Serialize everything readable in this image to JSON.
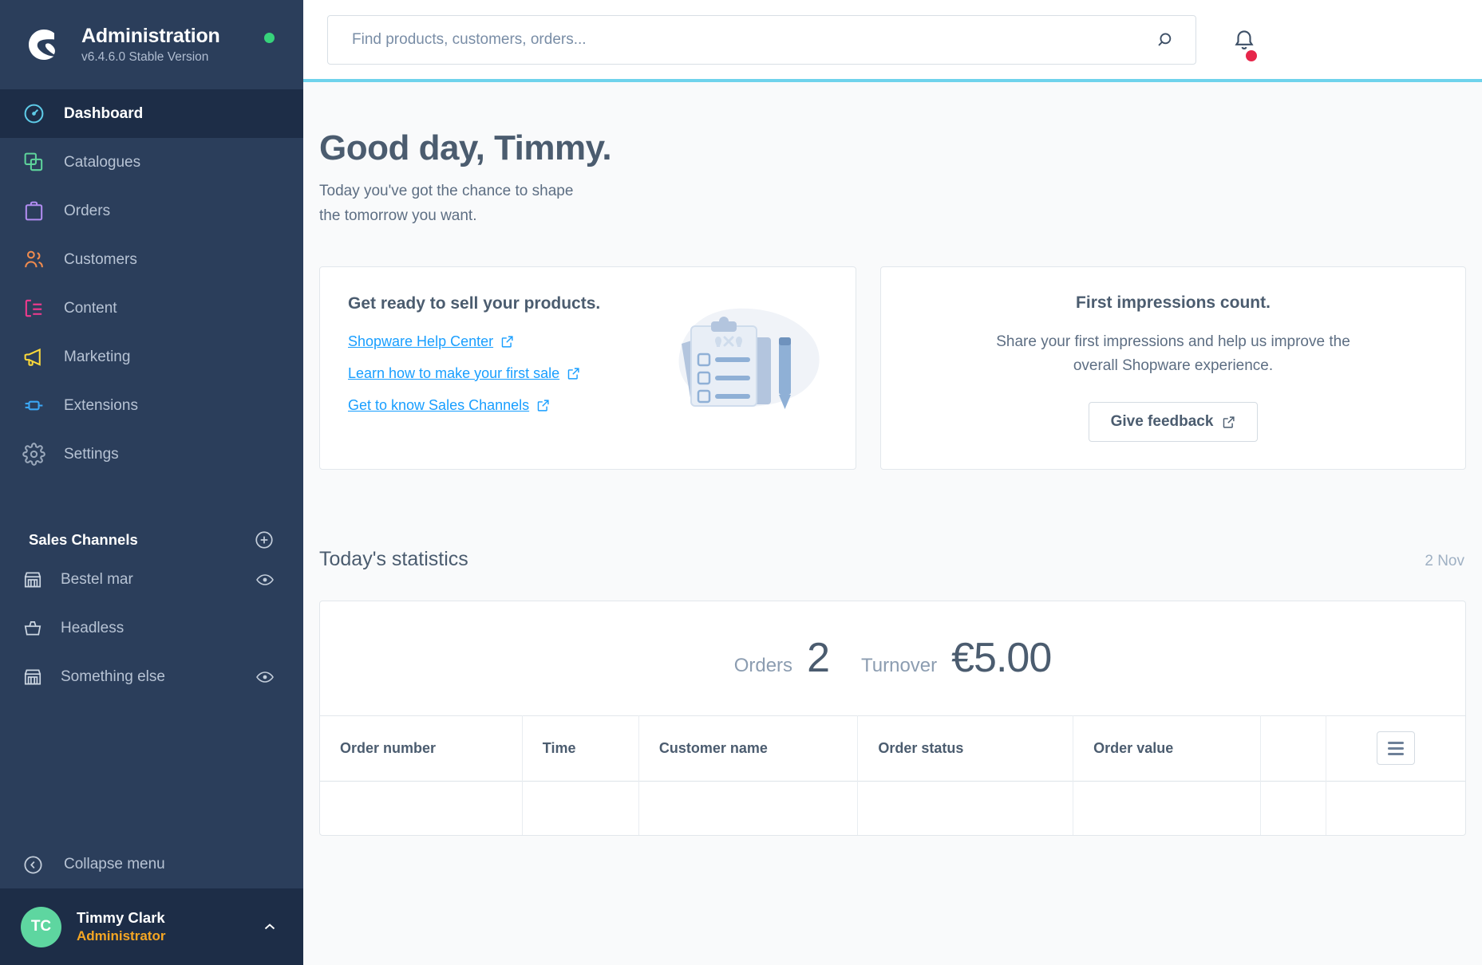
{
  "sidebar": {
    "brand": {
      "title": "Administration",
      "version": "v6.4.6.0 Stable Version",
      "status_dot_color": "#37d37b"
    },
    "nav": [
      {
        "label": "Dashboard",
        "icon": "gauge-icon",
        "color": "#5ecbe8",
        "active": true
      },
      {
        "label": "Catalogues",
        "icon": "copy-icon",
        "color": "#5ed39b",
        "active": false
      },
      {
        "label": "Orders",
        "icon": "bag-icon",
        "color": "#b18cf0",
        "active": false
      },
      {
        "label": "Customers",
        "icon": "users-icon",
        "color": "#f08b4e",
        "active": false
      },
      {
        "label": "Content",
        "icon": "content-icon",
        "color": "#f23a8e",
        "active": false
      },
      {
        "label": "Marketing",
        "icon": "megaphone-icon",
        "color": "#fcd93a",
        "active": false
      },
      {
        "label": "Extensions",
        "icon": "plug-icon",
        "color": "#3ba6f5",
        "active": false
      },
      {
        "label": "Settings",
        "icon": "gear-icon",
        "color": "#9aa8bb",
        "active": false
      }
    ],
    "sales_channels": {
      "title": "Sales Channels",
      "add_label": "+",
      "items": [
        {
          "label": "Bestel mar",
          "icon": "storefront-icon",
          "has_eye": true
        },
        {
          "label": "Headless",
          "icon": "basket-icon",
          "has_eye": false
        },
        {
          "label": "Something else",
          "icon": "storefront-icon",
          "has_eye": true
        }
      ]
    },
    "collapse": {
      "label": "Collapse menu",
      "icon": "chevron-left-circle-icon"
    },
    "user": {
      "initials": "TC",
      "name": "Timmy Clark",
      "role": "Administrator",
      "avatar_color": "#5ed6a0",
      "role_color": "#f5a623"
    }
  },
  "topbar": {
    "search": {
      "placeholder": "Find products, customers, orders...",
      "value": "",
      "icon": "search-icon"
    },
    "notifications": {
      "icon": "bell-icon",
      "has_badge": true,
      "badge_color": "#e6264a"
    },
    "accent_color": "#6fd3ec"
  },
  "greeting": {
    "heading": "Good day, Timmy.",
    "subtext": "Today you've got the chance to shape the tomorrow you want."
  },
  "card_sell": {
    "title": "Get ready to sell your products.",
    "links": [
      {
        "label": "Shopware Help Center",
        "icon": "external-link-icon"
      },
      {
        "label": "Learn how to make your first sale",
        "icon": "external-link-icon"
      },
      {
        "label": "Get to know Sales Channels",
        "icon": "external-link-icon"
      }
    ],
    "illustration": "clipboard-checklist-illustration"
  },
  "card_feedback": {
    "title": "First impressions count.",
    "text": "Share your first impressions and help us improve the overall Shopware experience.",
    "button": {
      "label": "Give feedback",
      "icon": "external-link-icon"
    }
  },
  "statistics": {
    "title": "Today's statistics",
    "date": "2 Nov",
    "kpis": [
      {
        "label": "Orders",
        "value": "2"
      },
      {
        "label": "Turnover",
        "value": "€5.00"
      }
    ],
    "table": {
      "columns": [
        "Order number",
        "Time",
        "Customer name",
        "Order status",
        "Order value",
        "",
        ""
      ],
      "rows": [],
      "settings_icon": "list-settings-icon"
    }
  }
}
